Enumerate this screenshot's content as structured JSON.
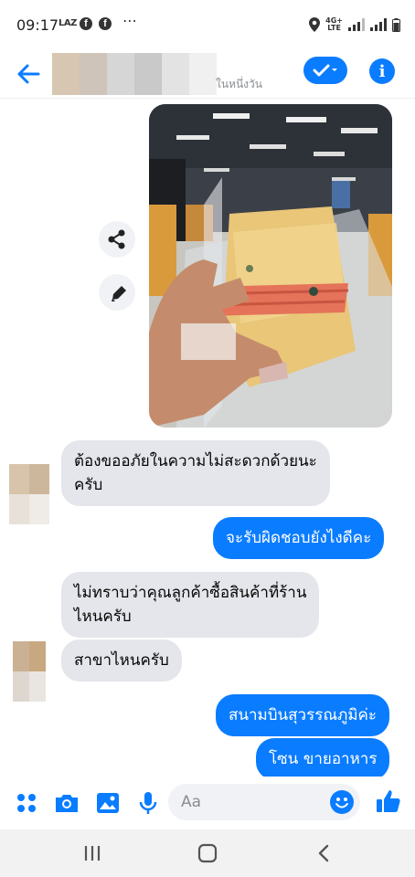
{
  "status_bar": {
    "time": "09:17",
    "left_badges": [
      "LAZ"
    ],
    "network_label_top": "4G+",
    "network_label_bottom": "LTE",
    "more_indicator": "⋯"
  },
  "header": {
    "subtitle": "ในหนึ่งวัน",
    "icons": [
      "back-arrow-icon",
      "check-icon",
      "info-icon"
    ],
    "accent_color": "#0a7cff"
  },
  "messages": [
    {
      "direction": "incoming",
      "text_line1": "ต้องขออภัยในความไม่สะดวกด้วยนะ",
      "text_line2": "ครับ"
    },
    {
      "direction": "outgoing",
      "text": "จะรับผิดชอบยังไงดีคะ"
    },
    {
      "direction": "incoming",
      "text_line1": "ไม่ทราบว่าคุณลูกค้าซื้อสินค้าที่ร้าน",
      "text_line2": "ไหนครับ"
    },
    {
      "direction": "incoming",
      "text": "สาขาไหนครับ"
    },
    {
      "direction": "outgoing",
      "text": "สนามบินสุวรรณภูมิค่ะ"
    },
    {
      "direction": "outgoing",
      "text": "โซน ขายอาหาร"
    }
  ],
  "photo": {
    "icons": [
      "share-icon",
      "edit-pencil-icon"
    ]
  },
  "composer": {
    "placeholder": "Aa",
    "icons": [
      "apps-grid-icon",
      "camera-icon",
      "gallery-icon",
      "microphone-icon",
      "emoji-icon",
      "thumbs-up-icon"
    ]
  },
  "nav_bar": {
    "icons": [
      "recent-apps-icon",
      "home-icon",
      "back-icon"
    ]
  },
  "colors": {
    "incoming_bubble": "#e4e6eb",
    "outgoing_bubble": "#0a7cff"
  }
}
